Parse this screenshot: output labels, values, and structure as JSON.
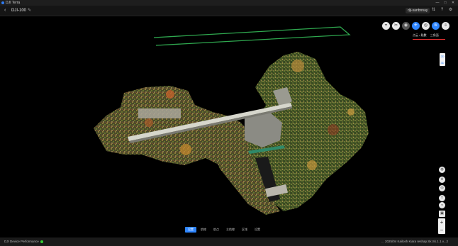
{
  "titlebar": {
    "title": "DJI Terra",
    "minimize": "—",
    "maximize": "□",
    "close": "✕"
  },
  "toolbar": {
    "back": "‹",
    "project_name": "DJI-100",
    "edit": "✎",
    "org": "dji-sanbnnay",
    "icons": {
      "expand": "⇅",
      "help": "?",
      "settings": "⚙"
    }
  },
  "viewer_tools": [
    {
      "name": "fit-view-icon",
      "glyph": "⌖",
      "active": false,
      "dark": false
    },
    {
      "name": "measure-icon",
      "glyph": "✂",
      "active": false,
      "dark": false
    },
    {
      "name": "compass-icon",
      "glyph": "◉",
      "active": false,
      "dark": true
    },
    {
      "name": "flight-icon",
      "glyph": "✈",
      "active": true,
      "dark": false
    },
    {
      "name": "camera-icon",
      "glyph": "◎",
      "active": false,
      "dark": false
    },
    {
      "name": "layers-icon",
      "glyph": "≋",
      "active": true,
      "dark": false
    },
    {
      "name": "export-icon",
      "glyph": "⇩",
      "active": false,
      "dark": false
    }
  ],
  "layer_tabs": [
    "点云 • 點數",
    "三角面"
  ],
  "side_stack": [
    "2D",
    "3D"
  ],
  "bottom_tabs": [
    "设置",
    "航線",
    "航点",
    "主航線",
    "区域",
    "设置"
  ],
  "statusbar": {
    "perf": "DJI Device Performance",
    "right": "... 2025/04 Kailosh Kiara reshap.Sk.Sk.1.1.v...2"
  },
  "colors": {
    "accent": "#2f86ff",
    "route": "#2fa84f"
  }
}
